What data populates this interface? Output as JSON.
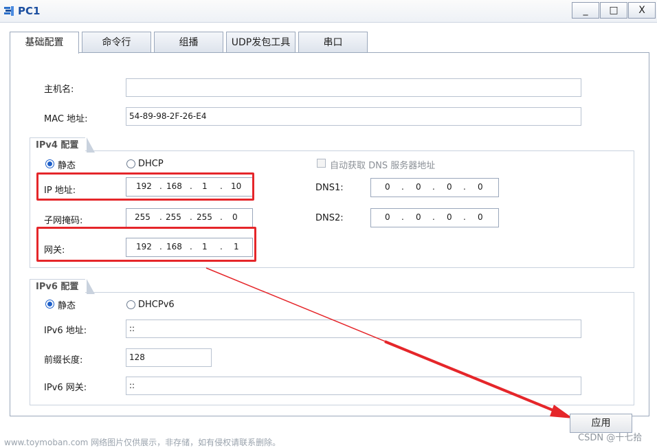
{
  "window": {
    "title": "PC1",
    "minimize": "_",
    "maximize": "□",
    "close": "X"
  },
  "tabs": [
    "基础配置",
    "命令行",
    "组播",
    "UDP发包工具",
    "串口"
  ],
  "basic": {
    "hostname_label": "主机名:",
    "hostname_value": "",
    "mac_label": "MAC 地址:",
    "mac_value": "54-89-98-2F-26-E4"
  },
  "ipv4": {
    "legend": "IPv4 配置",
    "static_label": "静态",
    "dhcp_label": "DHCP",
    "auto_dns_label": "自动获取 DNS 服务器地址",
    "ip_label": "IP 地址:",
    "ip": [
      "192",
      "168",
      "1",
      "10"
    ],
    "mask_label": "子网掩码:",
    "mask": [
      "255",
      "255",
      "255",
      "0"
    ],
    "gateway_label": "网关:",
    "gateway": [
      "192",
      "168",
      "1",
      "1"
    ],
    "dns1_label": "DNS1:",
    "dns1": [
      "0",
      "0",
      "0",
      "0"
    ],
    "dns2_label": "DNS2:",
    "dns2": [
      "0",
      "0",
      "0",
      "0"
    ]
  },
  "ipv6": {
    "legend": "IPv6 配置",
    "static_label": "静态",
    "dhcpv6_label": "DHCPv6",
    "addr_label": "IPv6 地址:",
    "addr_value": "::",
    "prefix_label": "前缀长度:",
    "prefix_value": "128",
    "gateway_label": "IPv6 网关:",
    "gateway_value": "::"
  },
  "apply_label": "应用",
  "watermark_left": "www.toymoban.com 网络图片仅供展示，非存储，如有侵权请联系删除。",
  "watermark_right": "CSDN @十七拾",
  "colors": {
    "highlight": "#e5262a",
    "accent": "#1d5fc9"
  }
}
